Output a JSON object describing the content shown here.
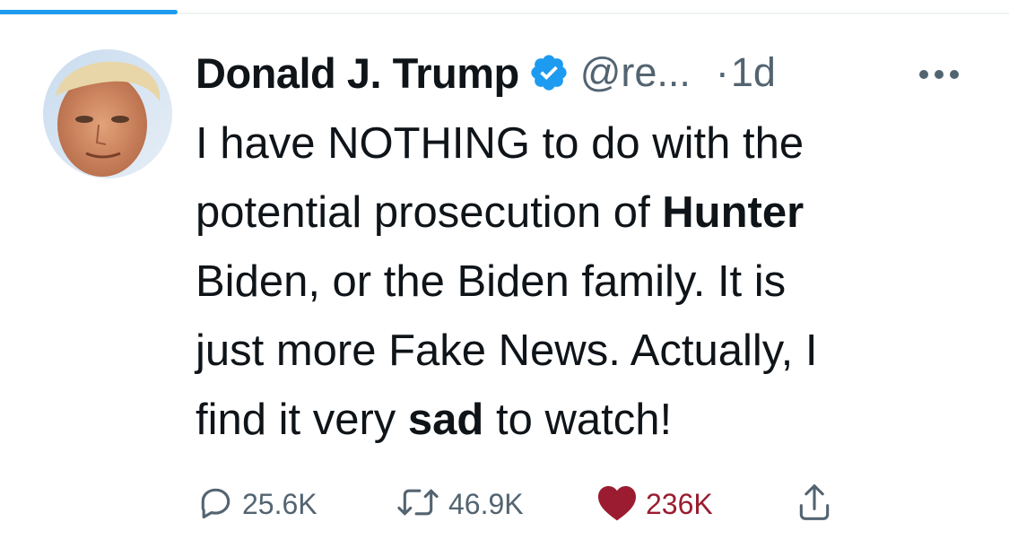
{
  "tweet": {
    "author": {
      "display_name": "Donald J. Trump",
      "handle": "@re...",
      "verified": true
    },
    "separator": "·",
    "time": "1d",
    "text_parts": [
      {
        "text": "I have NOTHING to do with the\npotential prosecution of ",
        "bold": false
      },
      {
        "text": "Hunter",
        "bold": true
      },
      {
        "text": "\nBiden, or the Biden family. It is\njust more Fake News. Actually, I\nfind it very ",
        "bold": false
      },
      {
        "text": "sad",
        "bold": true
      },
      {
        "text": " to watch!",
        "bold": false
      }
    ],
    "stats": {
      "replies": "25.6K",
      "retweets": "46.9K",
      "likes": "236K"
    }
  },
  "icons": {
    "reply": "speech-bubble-icon",
    "retweet": "retweet-arrows-icon",
    "like": "heart-icon",
    "share": "share-upload-icon",
    "more": "more-dots-icon",
    "verified": "verified-badge-icon"
  },
  "colors": {
    "accent": "#1d9bf0",
    "text": "#0f1419",
    "secondary": "#536471",
    "like": "#9b1c30"
  }
}
